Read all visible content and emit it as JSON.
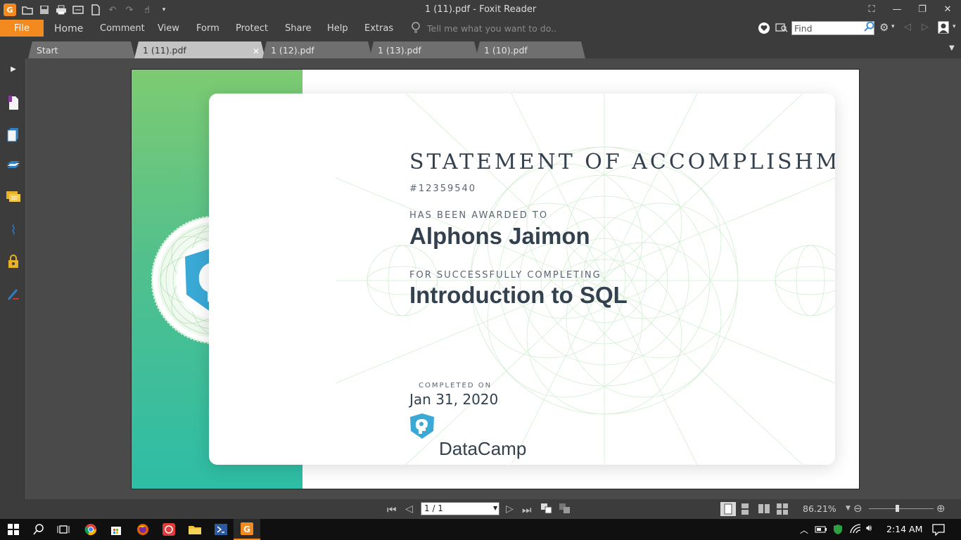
{
  "window": {
    "title": "1 (11).pdf - Foxit Reader"
  },
  "menu": {
    "file": "File",
    "items": [
      "Home",
      "Comment",
      "View",
      "Form",
      "Protect",
      "Share",
      "Help",
      "Extras"
    ],
    "tell_me_placeholder": "Tell me what you want to do..",
    "find_placeholder": "Find"
  },
  "tabs": [
    {
      "label": "Start"
    },
    {
      "label": "1 (11).pdf",
      "active": true
    },
    {
      "label": "1 (12).pdf"
    },
    {
      "label": "1 (13).pdf"
    },
    {
      "label": "1 (10).pdf"
    }
  ],
  "certificate": {
    "title": "STATEMENT OF ACCOMPLISHMENT",
    "id": "#12359540",
    "awarded_label": "HAS BEEN AWARDED TO",
    "name": "Alphons Jaimon",
    "completing_label": "FOR SUCCESSFULLY COMPLETING",
    "course": "Introduction to SQL",
    "completed_label": "COMPLETED ON",
    "completed_date": "Jan 31, 2020",
    "brand": "DataCamp"
  },
  "status": {
    "page": "1 / 1",
    "zoom": "86.21%"
  },
  "taskbar": {
    "time": "2:14 AM"
  },
  "colors": {
    "file_accent": "#f28a1f",
    "datacamp_blue": "#3aa9d6",
    "cert_green": "#52c08c"
  }
}
